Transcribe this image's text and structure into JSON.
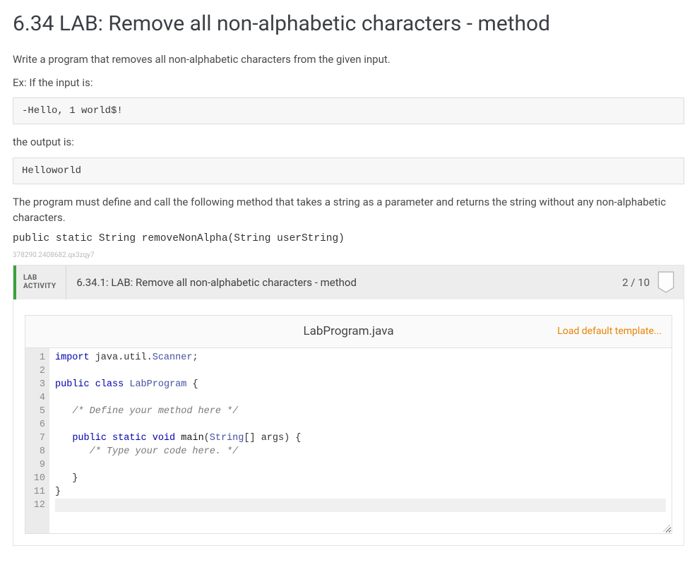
{
  "title": "6.34 LAB: Remove all non-alphabetic characters - method",
  "intro": "Write a program that removes all non-alphabetic characters from the given input.",
  "ex_input_label": "Ex: If the input is:",
  "ex_input": "-Hello, 1 world$!",
  "ex_output_label": "the output is:",
  "ex_output": "Helloworld",
  "must_define": "The program must define and call the following method that takes a string as a parameter and returns the string without any non-alphabetic characters.",
  "method_sig": "public static String removeNonAlpha(String userString)",
  "hash": "378290.2408682.qx3zqy7",
  "activity": {
    "type_line1": "LAB",
    "type_line2": "ACTIVITY",
    "title": "6.34.1: LAB: Remove all non-alphabetic characters - method",
    "score": "2 / 10"
  },
  "editor": {
    "filename": "LabProgram.java",
    "load_link": "Load default template...",
    "line_count": 12,
    "highlight_line": 12,
    "code_html": [
      "<span class='kw'>import</span> java.util.<span class='type'>Scanner</span>;",
      "",
      "<span class='kw'>public</span> <span class='kw'>class</span> <span class='type'>LabProgram</span> {",
      "",
      "   <span class='cmt'>/* Define your method here */</span>",
      "",
      "   <span class='kw'>public</span> <span class='kw'>static</span> <span class='kw'>void</span> <span class='ident'>main</span>(<span class='type'>String</span>[] args) {",
      "      <span class='cmt'>/* Type your code here. */</span>",
      "",
      "   }",
      "}",
      ""
    ]
  }
}
